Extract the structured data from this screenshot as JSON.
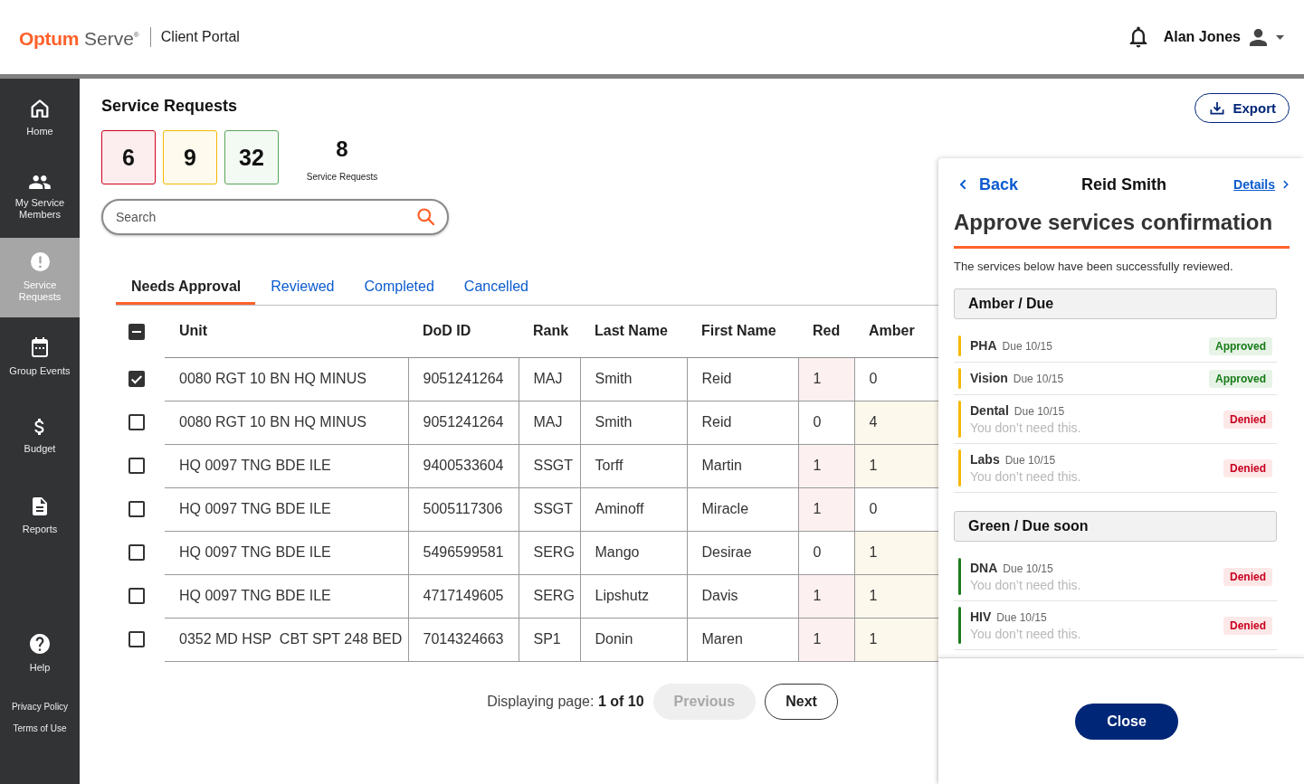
{
  "header": {
    "logo": {
      "brand": "Optum",
      "product": "Serve",
      "mark": "®"
    },
    "portal": "Client Portal",
    "user": "Alan Jones"
  },
  "sidebar": {
    "items": [
      {
        "label": "Home",
        "selected": false
      },
      {
        "label": "My Service Members",
        "selected": false
      },
      {
        "label": "Service Requests",
        "selected": true
      },
      {
        "label": "Group Events",
        "selected": false
      },
      {
        "label": "Budget",
        "selected": false
      },
      {
        "label": "Reports",
        "selected": false
      }
    ],
    "help": "Help",
    "links": [
      "Privacy Policy",
      "Terms of Use"
    ]
  },
  "page": {
    "title": "Service Requests",
    "export": "Export",
    "counts": [
      {
        "value": "6",
        "color": "#d0021b"
      },
      {
        "value": "9",
        "color": "#f5b800"
      },
      {
        "value": "32",
        "color": "#5aa55a"
      }
    ],
    "total": {
      "value": "8",
      "label": "Service Requests"
    },
    "search": {
      "placeholder": "Search"
    }
  },
  "tabs": [
    {
      "label": "Needs Approval",
      "selected": true
    },
    {
      "label": "Reviewed",
      "selected": false
    },
    {
      "label": "Completed",
      "selected": false
    },
    {
      "label": "Cancelled",
      "selected": false
    }
  ],
  "table": {
    "select_all": {
      "partial": true
    },
    "columns": [
      "Unit",
      "DoD ID",
      "Rank",
      "Last Name",
      "First Name",
      "Red",
      "Amber"
    ],
    "rows": [
      {
        "selected": true,
        "cells": [
          "0080 RGT 10 BN HQ MINUS",
          "9051241264",
          "MAJ",
          "Smith",
          "Reid"
        ],
        "counts": [
          {
            "value": "1",
            "flagged": true
          },
          {
            "value": "0",
            "flagged": false
          }
        ]
      },
      {
        "selected": false,
        "cells": [
          "0080 RGT 10 BN HQ MINUS",
          "9051241264",
          "MAJ",
          "Smith",
          "Reid"
        ],
        "counts": [
          {
            "value": "0",
            "flagged": false
          },
          {
            "value": "4",
            "flagged": true
          }
        ]
      },
      {
        "selected": false,
        "cells": [
          "HQ 0097 TNG BDE ILE",
          "9400533604",
          "SSGT",
          "Torff",
          "Martin"
        ],
        "counts": [
          {
            "value": "1",
            "flagged": true
          },
          {
            "value": "1",
            "flagged": true
          }
        ]
      },
      {
        "selected": false,
        "cells": [
          "HQ 0097 TNG BDE ILE",
          "5005117306",
          "SSGT",
          "Aminoff",
          "Miracle"
        ],
        "counts": [
          {
            "value": "1",
            "flagged": true
          },
          {
            "value": "0",
            "flagged": false
          }
        ]
      },
      {
        "selected": false,
        "cells": [
          "HQ 0097 TNG BDE ILE",
          "5496599581",
          "SERG",
          "Mango",
          "Desirae"
        ],
        "counts": [
          {
            "value": "0",
            "flagged": false
          },
          {
            "value": "1",
            "flagged": true
          }
        ]
      },
      {
        "selected": false,
        "cells": [
          "HQ 0097 TNG BDE ILE",
          "4717149605",
          "SERG",
          "Lipshutz",
          "Davis"
        ],
        "counts": [
          {
            "value": "1",
            "flagged": true
          },
          {
            "value": "1",
            "flagged": true
          }
        ]
      },
      {
        "selected": false,
        "cells": [
          "0352 MD HSP  CBT SPT 248 BED",
          "7014324663",
          "SP1",
          "Donin",
          "Maren"
        ],
        "counts": [
          {
            "value": "1",
            "flagged": true
          },
          {
            "value": "1",
            "flagged": true
          }
        ]
      }
    ]
  },
  "pagination": {
    "label": "Displaying page: **1 of 10**",
    "previous": {
      "label": "Previous",
      "disabled": true
    },
    "next": {
      "label": "Next",
      "disabled": false
    }
  },
  "panel": {
    "back": "Back",
    "name": "Reid Smith",
    "details": "Details",
    "title": "Approve services confirmation",
    "message": "The services below have been successfully reviewed.",
    "groups": [
      {
        "title": "Amber / Due",
        "color": "#f5b800",
        "services": [
          {
            "name": "PHA",
            "due": "Due 10/15",
            "approved": true,
            "badge": "Approved"
          },
          {
            "name": "Vision",
            "due": "Due 10/15",
            "approved": true,
            "badge": "Approved"
          },
          {
            "name": "Dental",
            "due": "Due 10/15",
            "note": "You don’t need this.",
            "approved": false,
            "badge": "Denied"
          },
          {
            "name": "Labs",
            "due": "Due 10/15",
            "note": "You don’t need this.",
            "approved": false,
            "badge": "Denied"
          }
        ]
      },
      {
        "title": "Green / Due soon",
        "color": "#1e7b1e",
        "services": [
          {
            "name": "DNA",
            "due": "Due 10/15",
            "note": "You don’t need this.",
            "approved": false,
            "badge": "Denied"
          },
          {
            "name": "HIV",
            "due": "Due 10/15",
            "note": "You don’t need this.",
            "approved": false,
            "badge": "Denied"
          }
        ]
      }
    ],
    "close": "Close"
  }
}
